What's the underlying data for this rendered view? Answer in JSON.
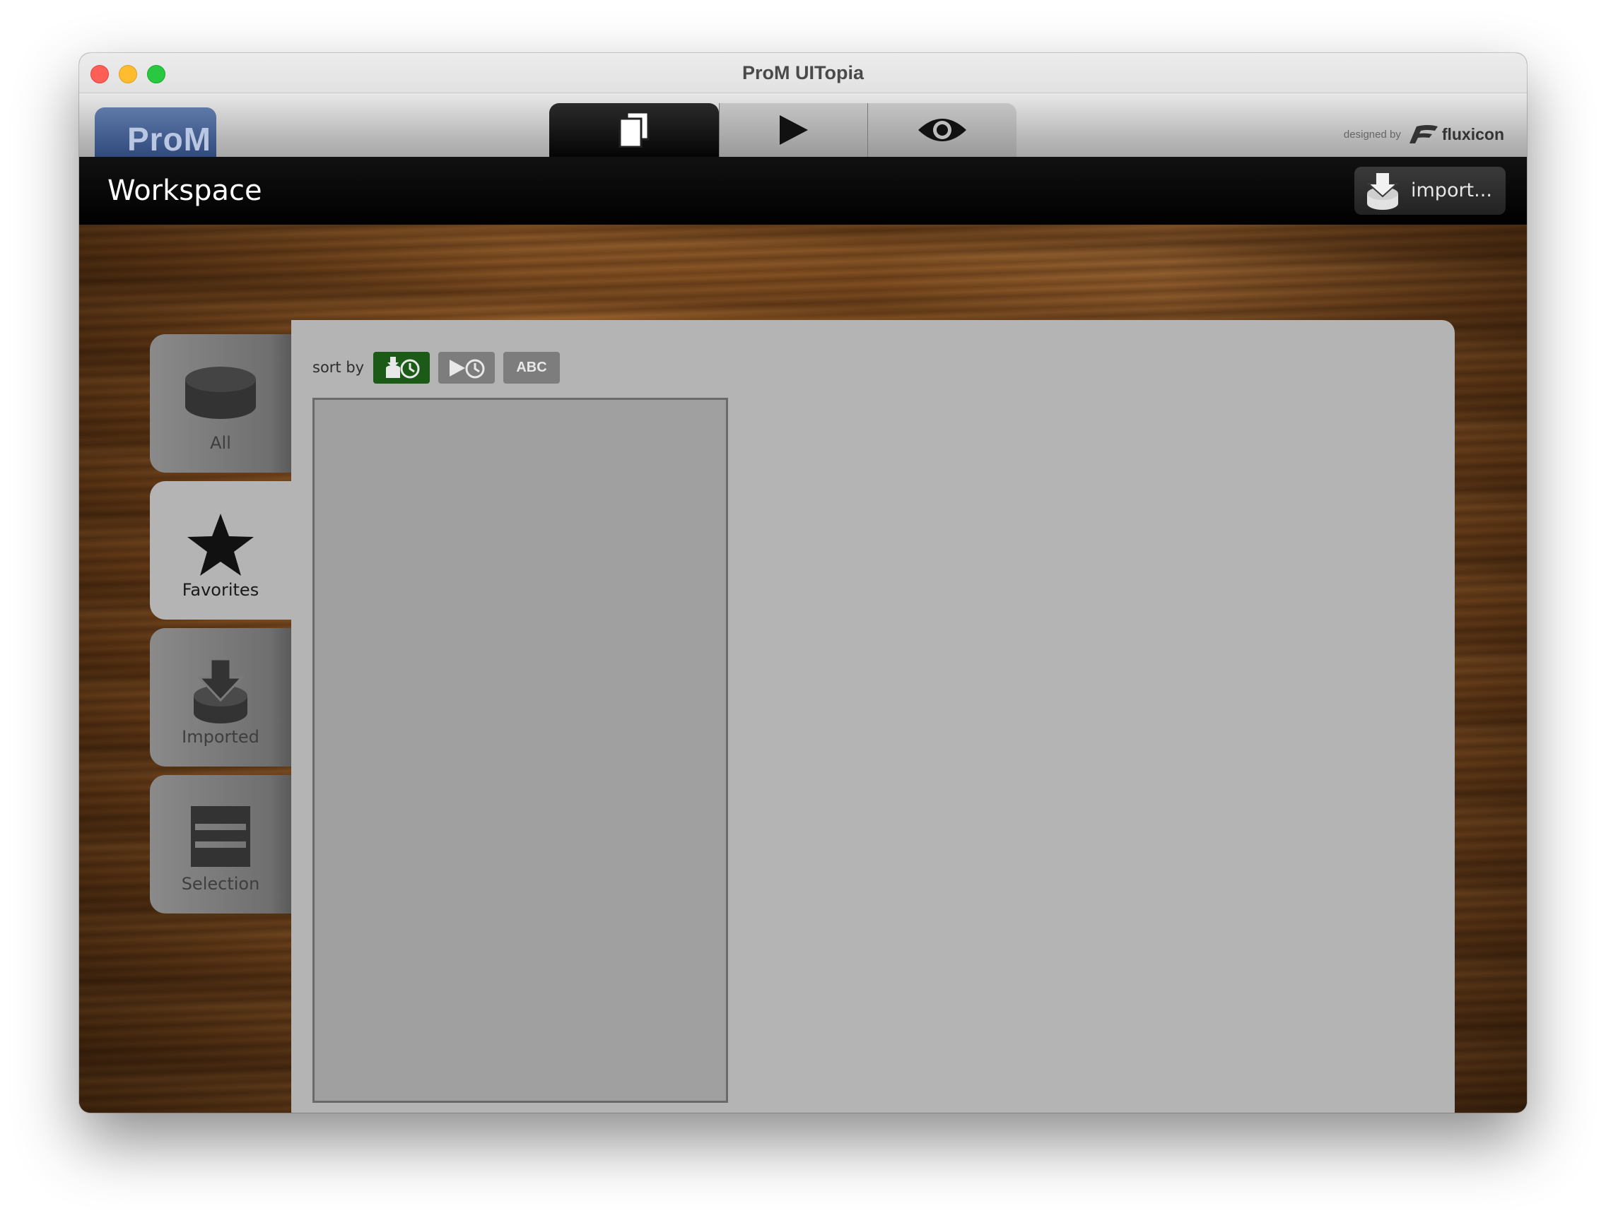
{
  "window": {
    "title": "ProM UITopia"
  },
  "toolbar": {
    "logo_text": "ProM",
    "tabs": [
      {
        "name": "workspace",
        "icon": "documents-icon",
        "active": true
      },
      {
        "name": "actions",
        "icon": "play-icon",
        "active": false
      },
      {
        "name": "views",
        "icon": "eye-icon",
        "active": false
      }
    ],
    "designed_by_label": "designed by",
    "designed_by_brand": "fluxicon"
  },
  "header": {
    "title": "Workspace",
    "import_label": "import..."
  },
  "sidebar": {
    "items": [
      {
        "label": "All",
        "icon": "database-icon",
        "active": false
      },
      {
        "label": "Favorites",
        "icon": "star-icon",
        "active": true
      },
      {
        "label": "Imported",
        "icon": "import-icon",
        "active": false
      },
      {
        "label": "Selection",
        "icon": "selection-icon",
        "active": false
      }
    ]
  },
  "panel": {
    "sort_label": "sort by",
    "sort_options": [
      {
        "icon": "import-time-icon",
        "active": true
      },
      {
        "icon": "action-time-icon",
        "active": false
      },
      {
        "label": "ABC",
        "active": false
      }
    ]
  },
  "colors": {
    "active_sort": "#1c5a17",
    "panel_bg": "#b4b4b4",
    "header_bg": "#000000",
    "logo_blue": "#2f4a7c"
  }
}
